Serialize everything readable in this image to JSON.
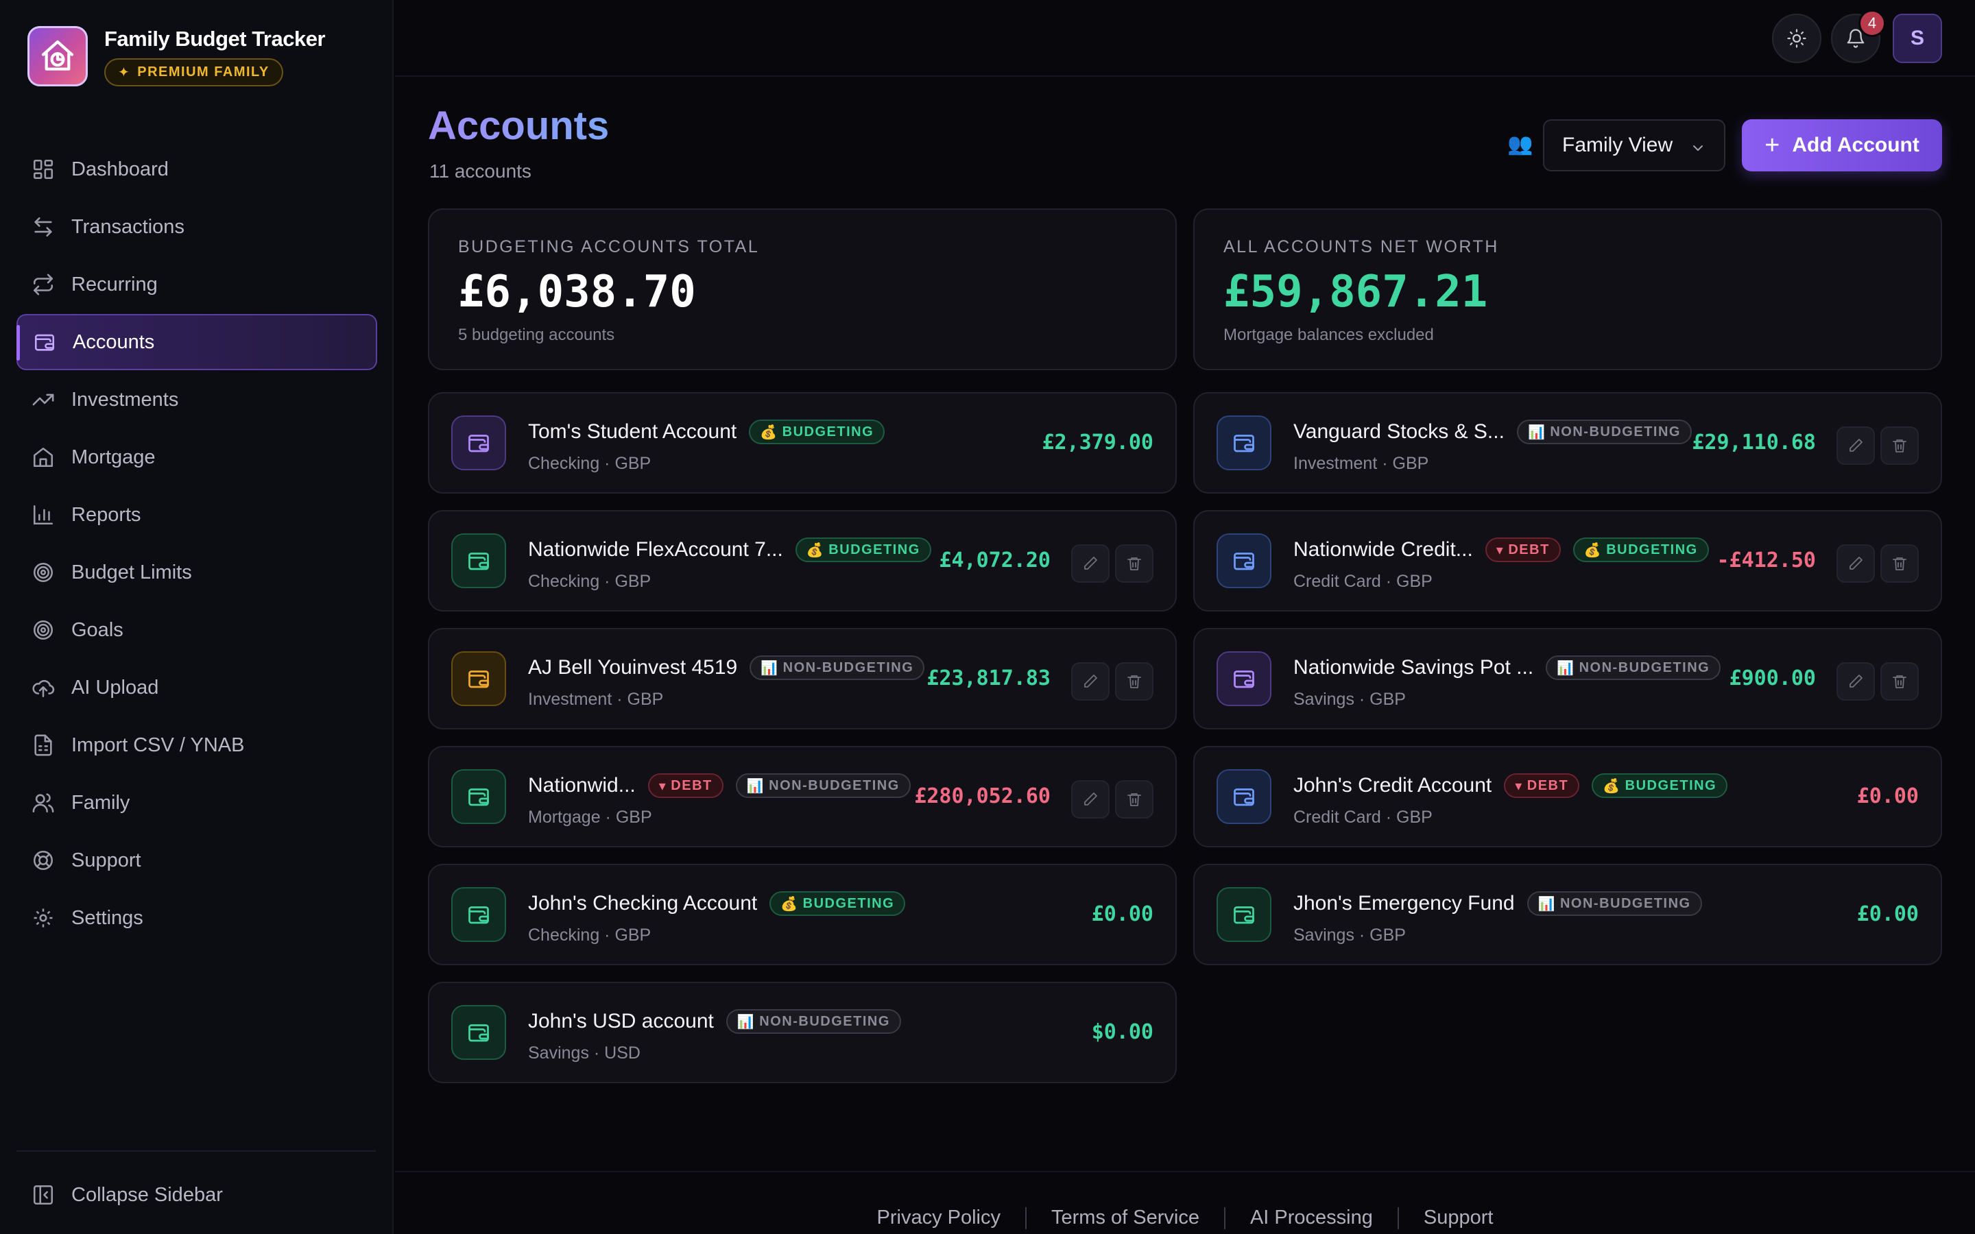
{
  "app": {
    "title": "Family Budget Tracker",
    "plan_badge": "PREMIUM FAMILY"
  },
  "colors": {
    "accent": "#8a5ef0",
    "positive": "#3fd6a0",
    "negative": "#f26b85",
    "budget_tag": "#3ed49a",
    "debt_tag": "#f06e82"
  },
  "sidebar": {
    "items": [
      {
        "label": "Dashboard",
        "icon": "dashboard-icon"
      },
      {
        "label": "Transactions",
        "icon": "arrows-left-right-icon"
      },
      {
        "label": "Recurring",
        "icon": "repeat-icon"
      },
      {
        "label": "Accounts",
        "icon": "wallet-icon",
        "active": true
      },
      {
        "label": "Investments",
        "icon": "trend-up-icon"
      },
      {
        "label": "Mortgage",
        "icon": "home-icon"
      },
      {
        "label": "Reports",
        "icon": "bar-chart-icon"
      },
      {
        "label": "Budget Limits",
        "icon": "target-icon"
      },
      {
        "label": "Goals",
        "icon": "goal-icon"
      },
      {
        "label": "AI Upload",
        "icon": "cloud-upload-icon"
      },
      {
        "label": "Import CSV / YNAB",
        "icon": "file-spreadsheet-icon"
      },
      {
        "label": "Family",
        "icon": "users-icon"
      },
      {
        "label": "Support",
        "icon": "lifebuoy-icon"
      },
      {
        "label": "Settings",
        "icon": "gear-icon"
      }
    ],
    "collapse_label": "Collapse Sidebar"
  },
  "header": {
    "notifications_count": "4",
    "avatar_initial": "S"
  },
  "page": {
    "title": "Accounts",
    "subtitle": "11 accounts",
    "view_selector": "Family View",
    "add_button": "Add Account"
  },
  "summary": {
    "budgeting": {
      "label": "BUDGETING ACCOUNTS TOTAL",
      "value": "£6,038.70",
      "note": "5 budgeting accounts"
    },
    "net_worth": {
      "label": "ALL ACCOUNTS NET WORTH",
      "value": "£59,867.21",
      "note": "Mortgage balances excluded"
    }
  },
  "tags": {
    "budgeting": "BUDGETING",
    "non_budgeting": "NON-BUDGETING",
    "debt": "DEBT"
  },
  "accounts": [
    {
      "name": "Tom's Student Account",
      "meta": "Checking · GBP",
      "amount": "£2,379.00"
    },
    {
      "name": "Vanguard Stocks & S...",
      "meta": "Investment · GBP",
      "amount": "£29,110.68"
    },
    {
      "name": "Nationwide FlexAccount 7...",
      "meta": "Checking · GBP",
      "amount": "£4,072.20"
    },
    {
      "name": "Nationwide Credit...",
      "meta": "Credit Card · GBP",
      "amount": "-£412.50"
    },
    {
      "name": "AJ Bell Youinvest 4519",
      "meta": "Investment · GBP",
      "amount": "£23,817.83"
    },
    {
      "name": "Nationwide Savings Pot ...",
      "meta": "Savings · GBP",
      "amount": "£900.00"
    },
    {
      "name": "Nationwid...",
      "meta": "Mortgage · GBP",
      "amount": "£280,052.60"
    },
    {
      "name": "John's Credit Account",
      "meta": "Credit Card · GBP",
      "amount": "£0.00"
    },
    {
      "name": "John's Checking Account",
      "meta": "Checking · GBP",
      "amount": "£0.00"
    },
    {
      "name": "Jhon's Emergency Fund",
      "meta": "Savings · GBP",
      "amount": "£0.00"
    },
    {
      "name": "John's USD account",
      "meta": "Savings · USD",
      "amount": "$0.00"
    }
  ],
  "footer": {
    "links": [
      "Privacy Policy",
      "Terms of Service",
      "AI Processing",
      "Support"
    ]
  }
}
